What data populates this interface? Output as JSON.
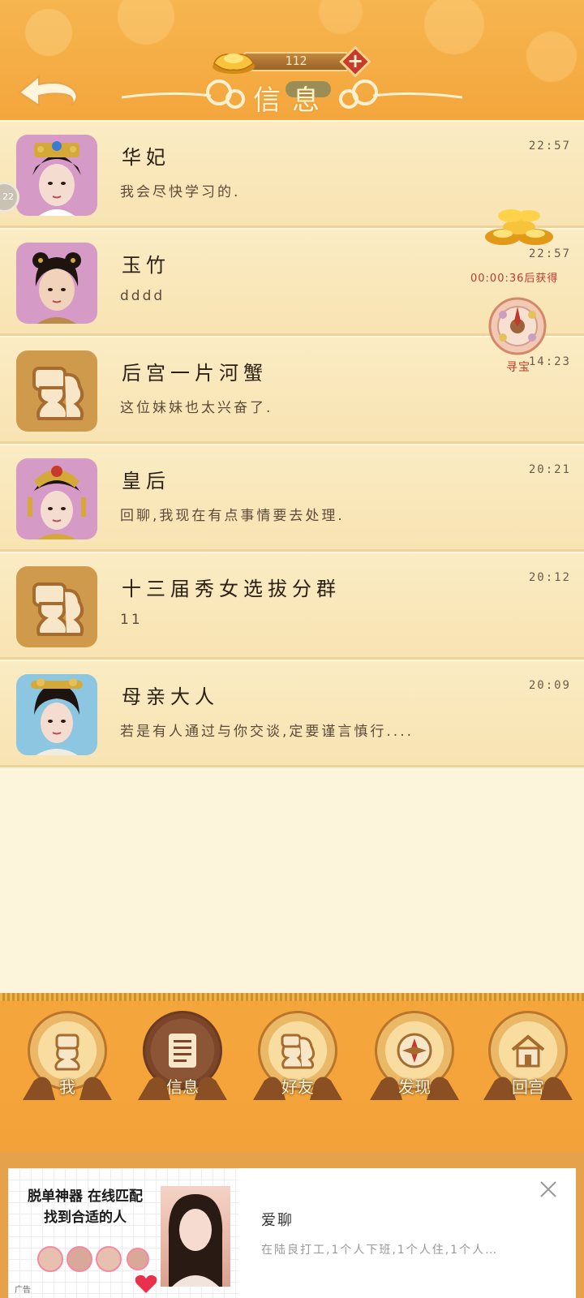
{
  "header": {
    "title": "信息",
    "gold_count": "112",
    "plus_label": "+"
  },
  "side_tab": {
    "label": "22"
  },
  "messages": [
    {
      "name": "华妃",
      "preview": "我会尽快学习的.",
      "time": "22:57",
      "avatar": "concubine-hua"
    },
    {
      "name": "玉竹",
      "preview": "dddd",
      "time": "22:57",
      "avatar": "yuzhu"
    },
    {
      "name": "后宫一片河蟹",
      "preview": "这位妹妹也太兴奋了.",
      "time": "14:23",
      "avatar": "group"
    },
    {
      "name": "皇后",
      "preview": "回聊,我现在有点事情要去处理.",
      "time": "20:21",
      "avatar": "empress"
    },
    {
      "name": "十三届秀女选拔分群",
      "preview": "11",
      "time": "20:12",
      "avatar": "group"
    },
    {
      "name": "母亲大人",
      "preview": "若是有人通过与你交谈,定要谨言慎行....",
      "time": "20:09",
      "avatar": "mother"
    }
  ],
  "widgets": {
    "treasure_timer": "00:00:36后获得",
    "wheel_label": "寻宝"
  },
  "nav": [
    {
      "label": "我",
      "icon": "profile-icon",
      "active": false
    },
    {
      "label": "信息",
      "icon": "message-icon",
      "active": true
    },
    {
      "label": "好友",
      "icon": "friends-icon",
      "active": false
    },
    {
      "label": "发现",
      "icon": "compass-icon",
      "active": false
    },
    {
      "label": "回宫",
      "icon": "home-icon",
      "active": false
    }
  ],
  "ad": {
    "headline_line1": "脱单神器 在线匹配",
    "headline_line2": "找到合适的人",
    "title": "爱聊",
    "description": "在陆良打工,1个人下班,1个人住,1个人…",
    "tag": "广告"
  },
  "colors": {
    "header_orange": "#f6b54f",
    "row_cream": "#fbecc4",
    "nav_active": "#8c5636",
    "red_accent": "#c0392b"
  }
}
